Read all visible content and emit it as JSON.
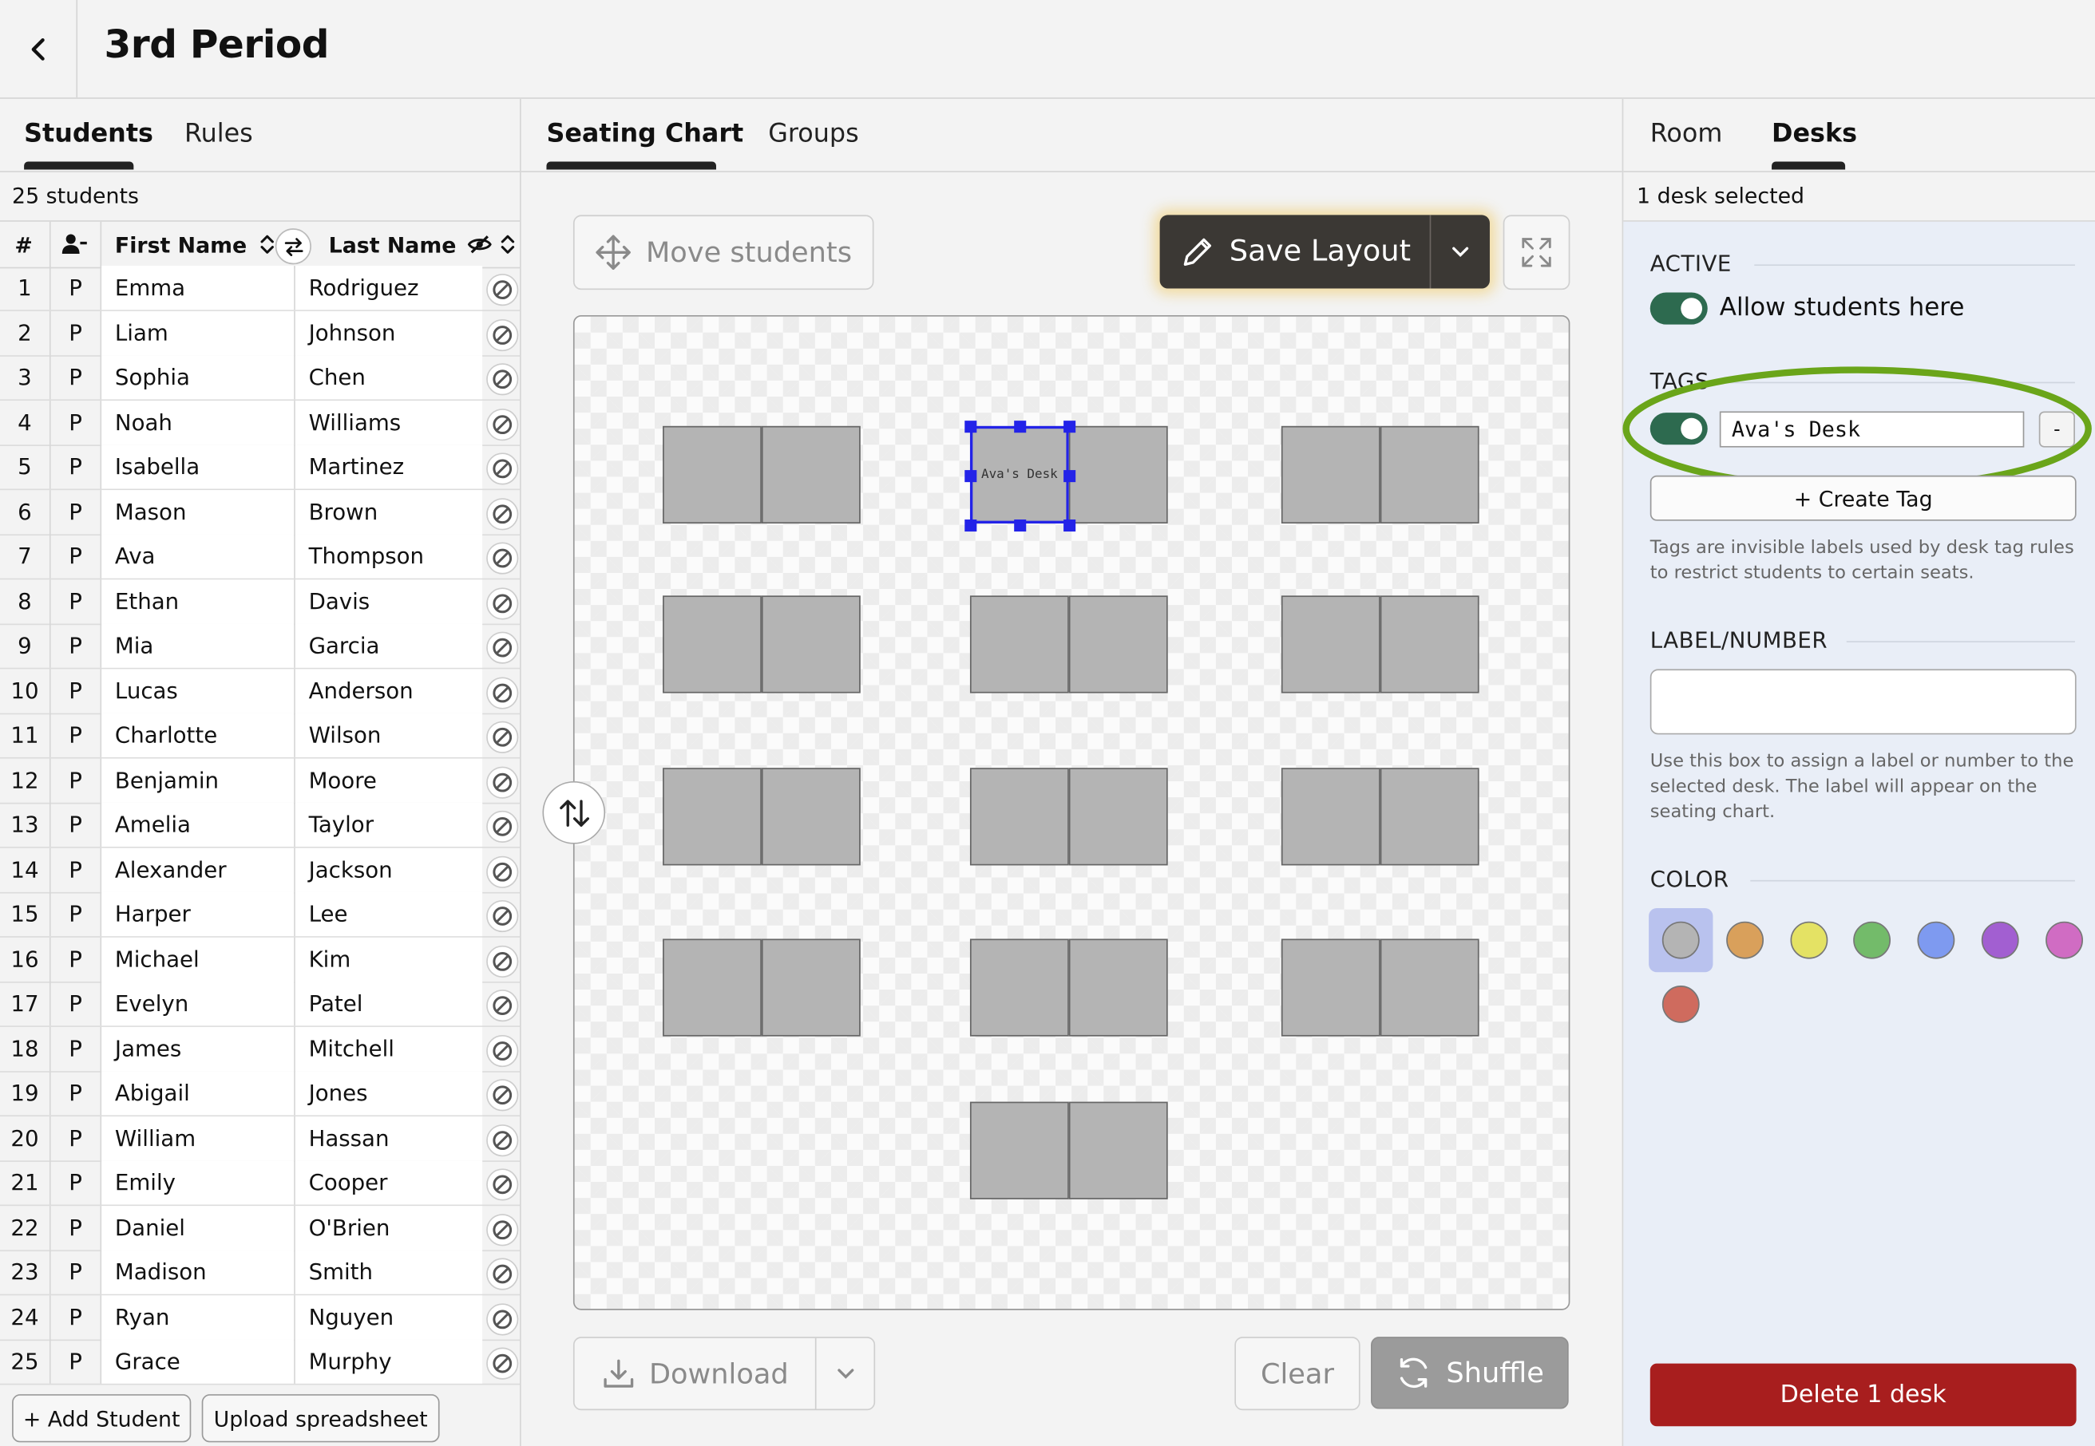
{
  "header": {
    "title": "3rd Period"
  },
  "left_tabs": [
    {
      "label": "Students",
      "active": true
    },
    {
      "label": "Rules",
      "active": false
    }
  ],
  "center_tabs": [
    {
      "label": "Seating Chart",
      "active": true
    },
    {
      "label": "Groups",
      "active": false
    }
  ],
  "right_tabs": [
    {
      "label": "Room",
      "active": false
    },
    {
      "label": "Desks",
      "active": true
    }
  ],
  "students": {
    "count_label": "25 students",
    "columns": {
      "num": "#",
      "first": "First Name",
      "last": "Last Name"
    },
    "rows": [
      {
        "n": "1",
        "s": "P",
        "first": "Emma",
        "last": "Rodriguez"
      },
      {
        "n": "2",
        "s": "P",
        "first": "Liam",
        "last": "Johnson"
      },
      {
        "n": "3",
        "s": "P",
        "first": "Sophia",
        "last": "Chen"
      },
      {
        "n": "4",
        "s": "P",
        "first": "Noah",
        "last": "Williams"
      },
      {
        "n": "5",
        "s": "P",
        "first": "Isabella",
        "last": "Martinez"
      },
      {
        "n": "6",
        "s": "P",
        "first": "Mason",
        "last": "Brown"
      },
      {
        "n": "7",
        "s": "P",
        "first": "Ava",
        "last": "Thompson"
      },
      {
        "n": "8",
        "s": "P",
        "first": "Ethan",
        "last": "Davis"
      },
      {
        "n": "9",
        "s": "P",
        "first": "Mia",
        "last": "Garcia"
      },
      {
        "n": "10",
        "s": "P",
        "first": "Lucas",
        "last": "Anderson"
      },
      {
        "n": "11",
        "s": "P",
        "first": "Charlotte",
        "last": "Wilson"
      },
      {
        "n": "12",
        "s": "P",
        "first": "Benjamin",
        "last": "Moore"
      },
      {
        "n": "13",
        "s": "P",
        "first": "Amelia",
        "last": "Taylor"
      },
      {
        "n": "14",
        "s": "P",
        "first": "Alexander",
        "last": "Jackson"
      },
      {
        "n": "15",
        "s": "P",
        "first": "Harper",
        "last": "Lee"
      },
      {
        "n": "16",
        "s": "P",
        "first": "Michael",
        "last": "Kim"
      },
      {
        "n": "17",
        "s": "P",
        "first": "Evelyn",
        "last": "Patel"
      },
      {
        "n": "18",
        "s": "P",
        "first": "James",
        "last": "Mitchell"
      },
      {
        "n": "19",
        "s": "P",
        "first": "Abigail",
        "last": "Jones"
      },
      {
        "n": "20",
        "s": "P",
        "first": "William",
        "last": "Hassan"
      },
      {
        "n": "21",
        "s": "P",
        "first": "Emily",
        "last": "Cooper"
      },
      {
        "n": "22",
        "s": "P",
        "first": "Daniel",
        "last": "O'Brien"
      },
      {
        "n": "23",
        "s": "P",
        "first": "Madison",
        "last": "Smith"
      },
      {
        "n": "24",
        "s": "P",
        "first": "Ryan",
        "last": "Nguyen"
      },
      {
        "n": "25",
        "s": "P",
        "first": "Grace",
        "last": "Murphy"
      }
    ],
    "add_student_label": "+ Add Student",
    "upload_label": "Upload spreadsheet"
  },
  "toolbar": {
    "move_students_label": "Move students",
    "save_layout_label": "Save Layout",
    "download_label": "Download",
    "clear_label": "Clear",
    "shuffle_label": "Shuffle"
  },
  "seating": {
    "selected_desk_label": "Ava's Desk",
    "desk_fill": "#b4b4b4",
    "selection_color": "#2323e8"
  },
  "desk_panel": {
    "selection_status": "1 desk selected",
    "active_heading": "ACTIVE",
    "allow_label": "Allow students here",
    "allow_enabled": true,
    "tags_heading": "TAGS",
    "tag_value": "Ava's Desk",
    "tag_enabled": true,
    "remove_tag_label": "-",
    "create_tag_label": "+ Create Tag",
    "tags_hint": "Tags are invisible labels used by desk tag rules to restrict students to certain seats.",
    "label_heading": "LABEL/NUMBER",
    "label_value": "",
    "label_hint": "Use this box to assign a label or number to the selected desk. The label will appear on the seating chart.",
    "color_heading": "COLOR",
    "colors": [
      "#b4b4b4",
      "#d9a05b",
      "#e4e264",
      "#73bb6a",
      "#7e9af0",
      "#a25fd1",
      "#d06cc3",
      "#cf6b5e"
    ],
    "selected_color": "#b4b4b4",
    "delete_label": "Delete 1 desk",
    "delete_color": "#a81e1e",
    "highlight_color": "#6aa51a"
  }
}
